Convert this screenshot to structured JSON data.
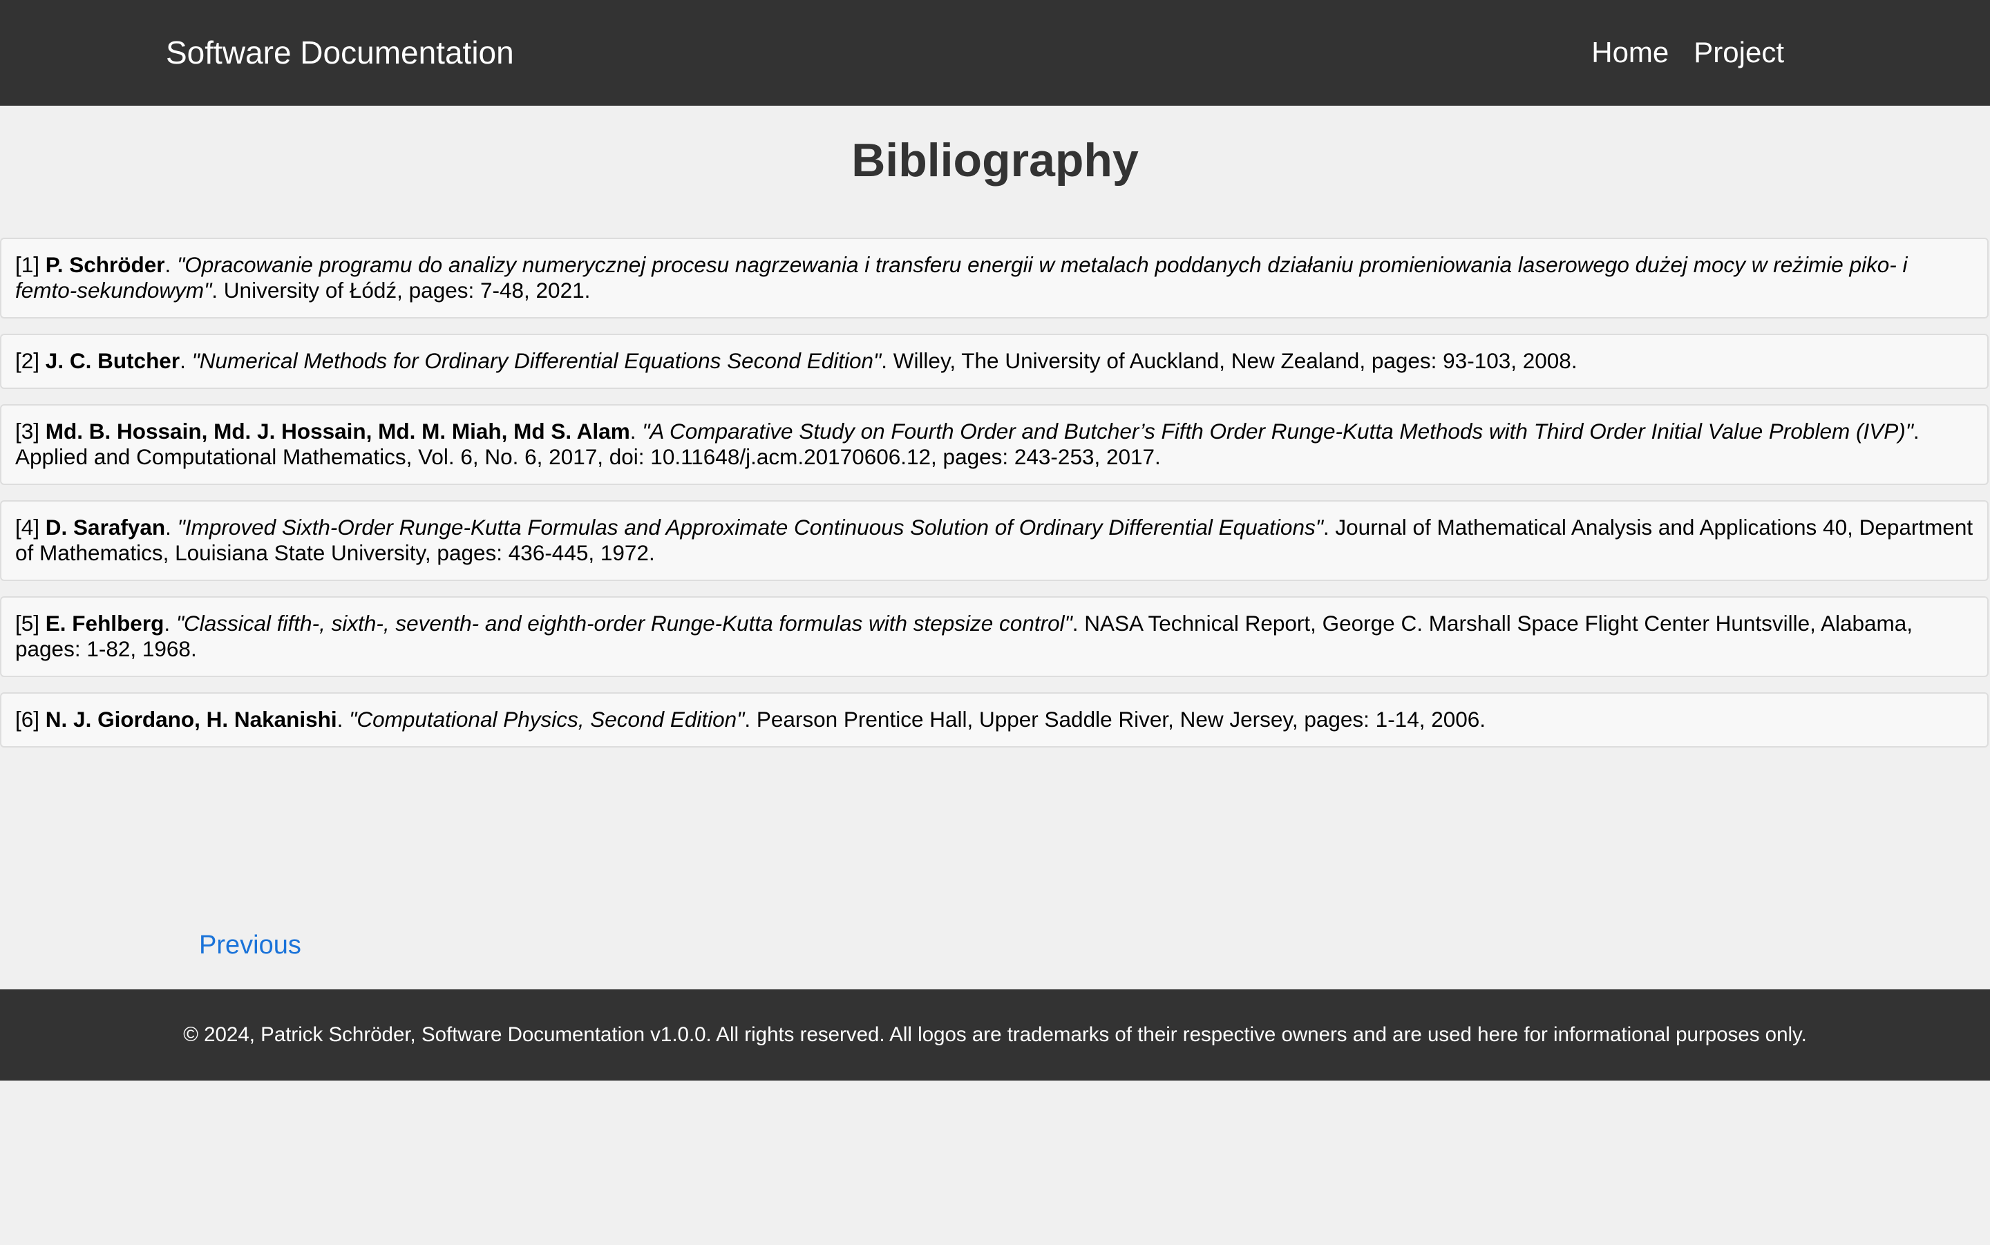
{
  "header": {
    "brand": "Software Documentation",
    "nav": [
      "Home",
      "Project"
    ]
  },
  "page_title": "Bibliography",
  "references": [
    {
      "number": "[1]",
      "authors": "P. Schröder",
      "title": "\"Opracowanie programu do analizy numerycznej procesu nagrzewania i transferu energii w metalach poddanych działaniu promieniowania laserowego dużej mocy w reżimie piko- i femto-sekundowym\"",
      "details": ". University of Łódź, pages: 7-48, 2021."
    },
    {
      "number": "[2]",
      "authors": "J. C. Butcher",
      "title": "\"Numerical Methods for Ordinary Differential Equations Second Edition\"",
      "details": ". Willey, The University of Auckland, New Zealand, pages: 93-103, 2008."
    },
    {
      "number": "[3]",
      "authors": "Md. B. Hossain, Md. J. Hossain, Md. M. Miah, Md S. Alam",
      "title": "\"A Comparative Study on Fourth Order and Butcher’s Fifth Order Runge-Kutta Methods with Third Order Initial Value Problem (IVP)\"",
      "details": ". Applied and Computational Mathematics, Vol. 6, No. 6, 2017, doi: 10.11648/j.acm.20170606.12, pages: 243-253, 2017."
    },
    {
      "number": "[4]",
      "authors": "D. Sarafyan",
      "title": "\"Improved Sixth-Order Runge-Kutta Formulas and Approximate Continuous Solution of Ordinary Differential Equations\"",
      "details": ". Journal of Mathematical Analysis and Applications 40, Department of Mathematics, Louisiana State University, pages: 436-445, 1972."
    },
    {
      "number": "[5]",
      "authors": "E. Fehlberg",
      "title": "\"Classical fifth-, sixth-, seventh- and eighth-order Runge-Kutta formulas with stepsize control\"",
      "details": ". NASA Technical Report, George C. Marshall Space Flight Center Huntsville, Alabama, pages: 1-82, 1968."
    },
    {
      "number": "[6]",
      "authors": "N. J. Giordano, H. Nakanishi",
      "title": "\"Computational Physics, Second Edition\"",
      "details": ". Pearson Prentice Hall, Upper Saddle River, New Jersey, pages: 1-14, 2006."
    }
  ],
  "pagination": {
    "previous": "Previous"
  },
  "footer": {
    "text": "© 2024, Patrick Schröder, Software Documentation v1.0.0. All rights reserved. All logos are trademarks of their respective owners and are used here for informational purposes only."
  },
  "colors": {
    "header_bg": "#333333",
    "page_bg": "#f0f0f0",
    "card_bg": "#f8f8f8",
    "link": "#1a73d9"
  }
}
